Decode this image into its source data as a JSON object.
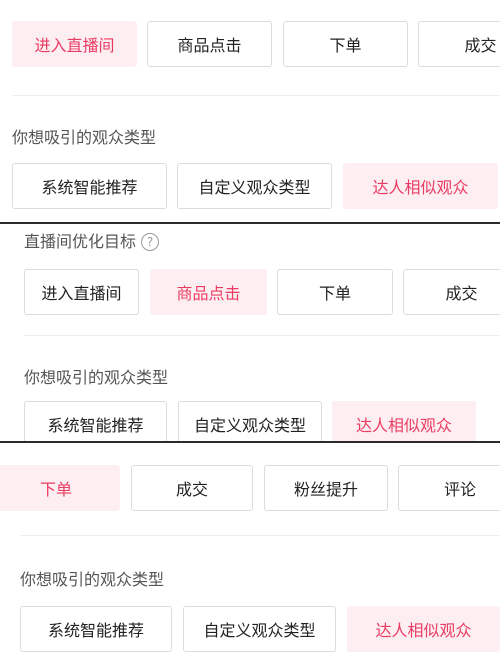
{
  "panel1": {
    "goal_options": [
      {
        "label": "进入直播间",
        "selected": true
      },
      {
        "label": "商品点击",
        "selected": false
      },
      {
        "label": "下单",
        "selected": false
      },
      {
        "label": "成交",
        "selected": false
      }
    ],
    "audience_title": "你想吸引的观众类型",
    "audience_options": [
      {
        "label": "系统智能推荐",
        "selected": false
      },
      {
        "label": "自定义观众类型",
        "selected": false
      },
      {
        "label": "达人相似观众",
        "selected": true
      }
    ]
  },
  "panel2": {
    "goal_title": "直播间优化目标",
    "help_icon": "?",
    "goal_options": [
      {
        "label": "进入直播间",
        "selected": false
      },
      {
        "label": "商品点击",
        "selected": true
      },
      {
        "label": "下单",
        "selected": false
      },
      {
        "label": "成交",
        "selected": false
      }
    ],
    "audience_title": "你想吸引的观众类型",
    "audience_options": [
      {
        "label": "系统智能推荐",
        "selected": false
      },
      {
        "label": "自定义观众类型",
        "selected": false
      },
      {
        "label": "达人相似观众",
        "selected": true
      }
    ]
  },
  "panel3": {
    "goal_options": [
      {
        "label": "下单",
        "selected": true
      },
      {
        "label": "成交",
        "selected": false
      },
      {
        "label": "粉丝提升",
        "selected": false
      },
      {
        "label": "评论",
        "selected": false
      }
    ],
    "audience_title": "你想吸引的观众类型",
    "audience_options": [
      {
        "label": "系统智能推荐",
        "selected": false
      },
      {
        "label": "自定义观众类型",
        "selected": false
      },
      {
        "label": "达人相似观众",
        "selected": true
      }
    ]
  },
  "colors": {
    "accent": "#ea3c63",
    "selected_bg": "#fdeef1",
    "border": "#dcdcdc"
  }
}
